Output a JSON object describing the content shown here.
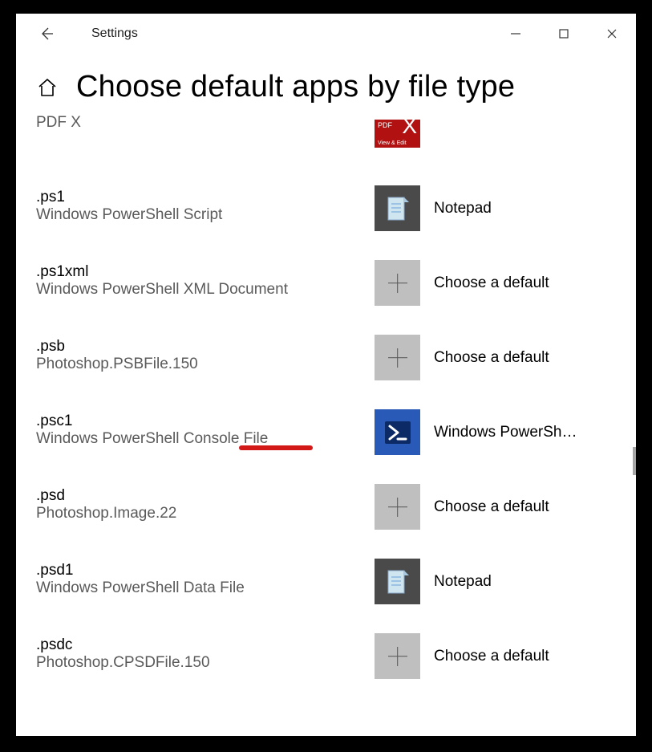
{
  "app_title": "Settings",
  "page_title": "Choose default apps by file type",
  "choose_default_label": "Choose a default",
  "rows": [
    {
      "ext": "",
      "desc": "PDF X",
      "app": "",
      "icon": "pdfx",
      "first": true
    },
    {
      "ext": ".ps1",
      "desc": "Windows PowerShell Script",
      "app": "Notepad",
      "icon": "notepad"
    },
    {
      "ext": ".ps1xml",
      "desc": "Windows PowerShell XML Document",
      "app": "Choose a default",
      "icon": "plus"
    },
    {
      "ext": ".psb",
      "desc": "Photoshop.PSBFile.150",
      "app": "Choose a default",
      "icon": "plus"
    },
    {
      "ext": ".psc1",
      "desc": "Windows PowerShell Console File",
      "app": "Windows PowerSh…",
      "icon": "ps"
    },
    {
      "ext": ".psd",
      "desc": "Photoshop.Image.22",
      "app": "Choose a default",
      "icon": "plus"
    },
    {
      "ext": ".psd1",
      "desc": "Windows PowerShell Data File",
      "app": "Notepad",
      "icon": "notepad"
    },
    {
      "ext": ".psdc",
      "desc": "Photoshop.CPSDFile.150",
      "app": "Choose a default",
      "icon": "plus"
    }
  ],
  "pdfx_label_top": "PDF",
  "pdfx_label_bottom": "View & Edit"
}
